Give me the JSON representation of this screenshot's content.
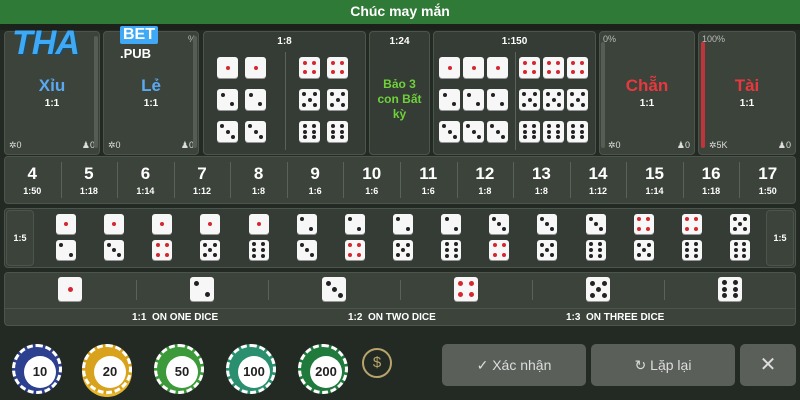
{
  "header": {
    "title": "Chúc may mắn"
  },
  "logo": {
    "main": "THA",
    "badge": "BET",
    "suffix": ".PUB"
  },
  "top_bets": {
    "xiu": {
      "label": "Xỉu",
      "ratio": "1:1",
      "chips": "0",
      "players": "0"
    },
    "le": {
      "label": "Lẻ",
      "ratio": "1:1",
      "chips": "0",
      "players": "0"
    },
    "doubles": {
      "ratio": "1:8"
    },
    "any_triple": {
      "ratio": "1:24",
      "label_lines": [
        "Bảo 3",
        "con Bất",
        "kỳ"
      ]
    },
    "triples": {
      "ratio": "1:150"
    },
    "chan": {
      "label": "Chẵn",
      "ratio": "1:1",
      "chips": "0",
      "players": "0",
      "percent": "0%",
      "percent_value": 0
    },
    "tai": {
      "label": "Tài",
      "ratio": "1:1",
      "chips": "5K",
      "players": "0",
      "percent": "100%",
      "percent_value": 1
    },
    "le_percent": "%"
  },
  "sums": [
    {
      "n": "4",
      "r": "1:50"
    },
    {
      "n": "5",
      "r": "1:18"
    },
    {
      "n": "6",
      "r": "1:14"
    },
    {
      "n": "7",
      "r": "1:12"
    },
    {
      "n": "8",
      "r": "1:8"
    },
    {
      "n": "9",
      "r": "1:6"
    },
    {
      "n": "10",
      "r": "1:6"
    },
    {
      "n": "11",
      "r": "1:6"
    },
    {
      "n": "12",
      "r": "1:8"
    },
    {
      "n": "13",
      "r": "1:8"
    },
    {
      "n": "14",
      "r": "1:12"
    },
    {
      "n": "15",
      "r": "1:14"
    },
    {
      "n": "16",
      "r": "1:18"
    },
    {
      "n": "17",
      "r": "1:50"
    }
  ],
  "combos": {
    "ratio_left": "1:5",
    "ratio_right": "1:5"
  },
  "single_dice": {
    "labels": [
      {
        "ratio": "1:1",
        "text": "ON ONE DICE"
      },
      {
        "ratio": "1:2",
        "text": "ON TWO DICE"
      },
      {
        "ratio": "1:3",
        "text": "ON THREE DICE"
      }
    ]
  },
  "chips": [
    "10",
    "20",
    "50",
    "100",
    "200"
  ],
  "buttons": {
    "confirm": "Xác nhận",
    "repeat": "Lặp lại",
    "close": "✕"
  },
  "colors": {
    "chan": "#e8383f",
    "tai": "#e8383f",
    "blue_word": "#5aa9f0",
    "any_triple": "#6fd13a"
  }
}
